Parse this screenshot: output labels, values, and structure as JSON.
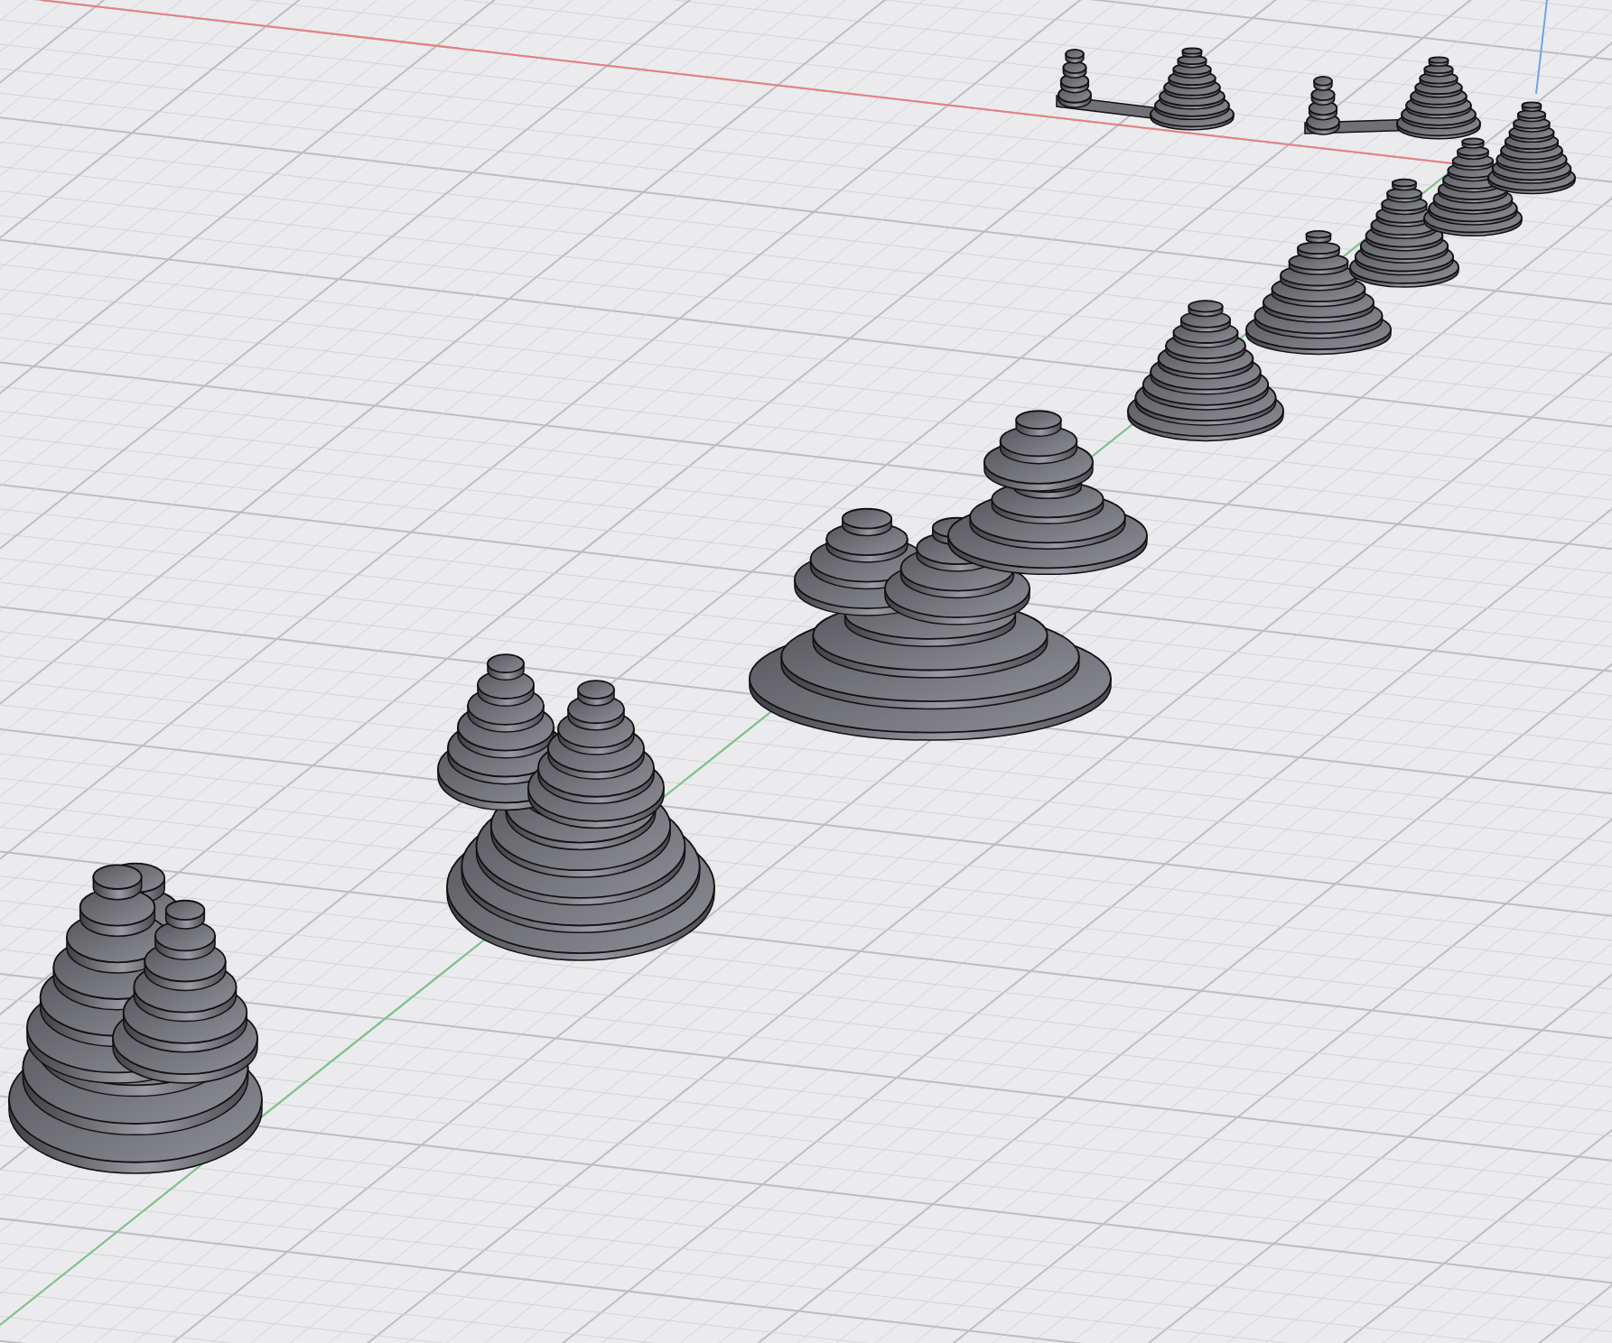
{
  "viewport": {
    "axes": [
      {
        "kind": "x",
        "color": "#e88080"
      },
      {
        "kind": "y",
        "color": "#7cc48c"
      },
      {
        "kind": "z",
        "color": "#6aa6ec"
      }
    ],
    "models": [
      {
        "kind": "twin"
      },
      {
        "kind": "twin"
      },
      {
        "kind": "cluster"
      },
      {
        "kind": "twin"
      },
      {
        "kind": "cone"
      },
      {
        "kind": "cone"
      },
      {
        "kind": "cone"
      },
      {
        "kind": "cone"
      },
      {
        "kind": "cone"
      },
      {
        "kind": "tower"
      },
      {
        "kind": "tower"
      }
    ]
  }
}
